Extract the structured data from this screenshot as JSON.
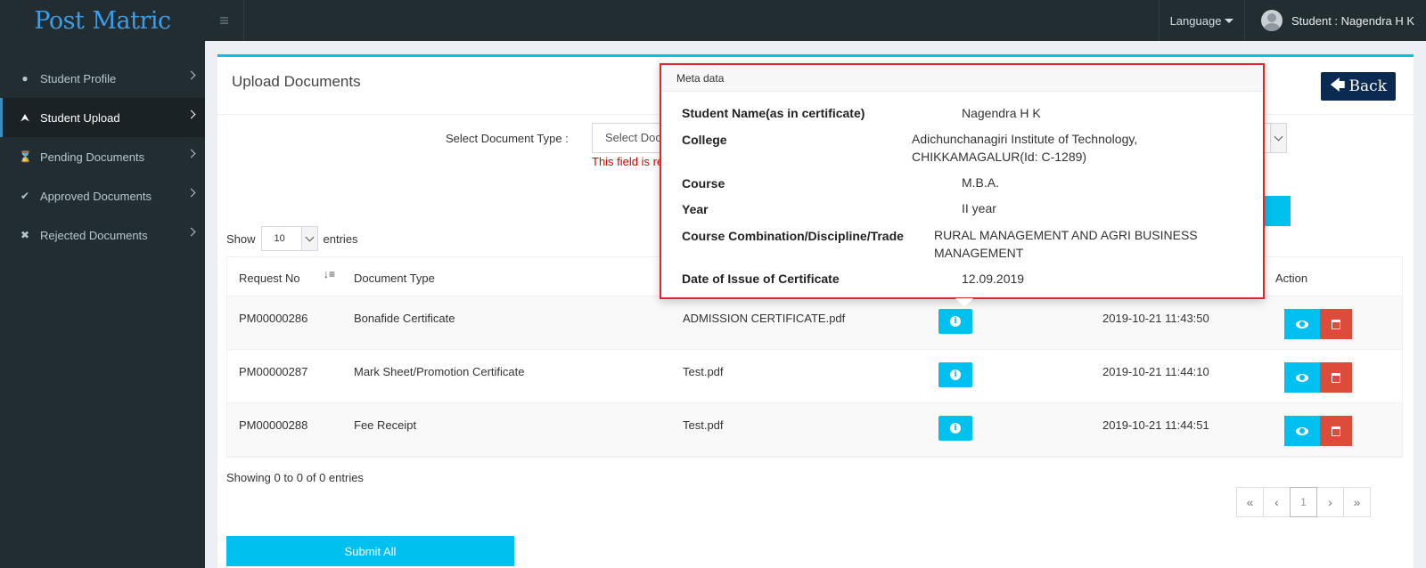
{
  "app": {
    "logo_part1": "Post",
    "logo_part2": "Matric",
    "language": "Language",
    "user_label": "Student : Nagendra H K"
  },
  "sidebar": {
    "items": [
      {
        "label": "Student Profile",
        "icon": "user-icon"
      },
      {
        "label": "Student Upload",
        "icon": "upload-icon",
        "active": true
      },
      {
        "label": "Pending Documents",
        "icon": "hourglass-icon"
      },
      {
        "label": "Approved Documents",
        "icon": "check-icon"
      },
      {
        "label": "Rejected Documents",
        "icon": "times-icon"
      }
    ]
  },
  "main": {
    "title": "Upload Documents",
    "back_label": "Back",
    "select_label": "Select Document Type :",
    "select_value": "Select Doc",
    "error_text": "This field is re",
    "show_label": "Show",
    "entries_value": "10",
    "entries_label": "entries",
    "showing_text": "Showing 0 to 0 of 0 entries",
    "submit_label": "Submit All",
    "page_current": "1"
  },
  "table": {
    "headers": {
      "request_no": "Request No",
      "document_type": "Document Type",
      "action": "Action"
    },
    "rows": [
      {
        "request_no": "PM00000286",
        "document_type": "Bonafide Certificate",
        "file": "ADMISSION CERTIFICATE.pdf",
        "date": "2019-10-21 11:43:50"
      },
      {
        "request_no": "PM00000287",
        "document_type": "Mark Sheet/Promotion Certificate",
        "file": "Test.pdf",
        "date": "2019-10-21 11:44:10"
      },
      {
        "request_no": "PM00000288",
        "document_type": "Fee Receipt",
        "file": "Test.pdf",
        "date": "2019-10-21 11:44:51"
      }
    ]
  },
  "popover": {
    "title": "Meta data",
    "fields": {
      "student_name_label": "Student Name(as in certificate)",
      "student_name": "Nagendra H K",
      "college_label": "College",
      "college_line1": "Adichunchanagiri Institute of Technology,",
      "college_line2": "CHIKKAMAGALUR(Id: C-1289)",
      "course_label": "Course",
      "course": "M.B.A.",
      "year_label": "Year",
      "year": "II year",
      "combination_label": "Course Combination/Discipline/Trade",
      "combination_line1": "RURAL MANAGEMENT AND AGRI BUSINESS",
      "combination_line2": "MANAGEMENT",
      "date_label": "Date of Issue of Certificate",
      "date": "12.09.2019"
    }
  },
  "colors": {
    "sidebar_bg": "#222d32",
    "accent": "#00c0ef",
    "danger": "#dd4b39",
    "back_btn": "#0a2a52",
    "highlight_border": "#e0262a"
  }
}
